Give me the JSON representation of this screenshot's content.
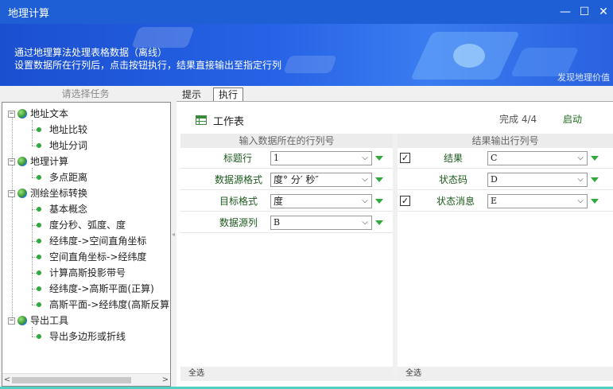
{
  "window": {
    "title": "地理计算",
    "minimize_glyph": "—",
    "maximize_glyph": "☐",
    "close_glyph": "✕"
  },
  "banner": {
    "line1": "通过地理算法处理表格数据（离线）",
    "line2": "设置数据所在行列后，点击按钮执行，结果直接输出至指定行列",
    "link": "发现地理价值"
  },
  "task_panel": {
    "header": "请选择任务",
    "groups": [
      {
        "label": "地址文本",
        "items": [
          "地址比较",
          "地址分词"
        ]
      },
      {
        "label": "地理计算",
        "items": [
          "多点距离"
        ]
      },
      {
        "label": "测绘坐标转换",
        "items": [
          "基本概念",
          "度分秒、弧度、度",
          "经纬度->空间直角坐标",
          "空间直角坐标->经纬度",
          "计算高斯投影带号",
          "经纬度->高斯平面(正算)",
          "高斯平面->经纬度(高斯反算"
        ]
      },
      {
        "label": "导出工具",
        "items": [
          "导出多边形或折线"
        ]
      }
    ]
  },
  "tabs": [
    {
      "label": "提示",
      "active": false
    },
    {
      "label": "执行",
      "active": true
    }
  ],
  "worksheet": {
    "title": "工作表",
    "progress": "完成 4/4",
    "start_label": "启动"
  },
  "input_section": {
    "header": "输入数据所在的行列号",
    "rows": [
      {
        "label": "标题行",
        "value": "1"
      },
      {
        "label": "数据源格式",
        "value": "度° 分′ 秒″"
      },
      {
        "label": "目标格式",
        "value": "度"
      },
      {
        "label": "数据源列",
        "value": "B"
      }
    ],
    "footer": "全选"
  },
  "output_section": {
    "header": "结果输出行列号",
    "rows": [
      {
        "label": "结果",
        "value": "C",
        "checked": true
      },
      {
        "label": "状态码",
        "value": "D",
        "checked": false,
        "has_checkbox": false
      },
      {
        "label": "状态消息",
        "value": "E",
        "checked": true
      }
    ],
    "footer": "全选"
  },
  "icons": {
    "expander_open": "−",
    "caret": "⌵",
    "check": "✓",
    "scroll_left": "<",
    "scroll_right": ">"
  },
  "colors": {
    "titlebar": "#1f5fd6",
    "accent_green": "#2faa3c",
    "label_green": "#1d5a1d"
  }
}
